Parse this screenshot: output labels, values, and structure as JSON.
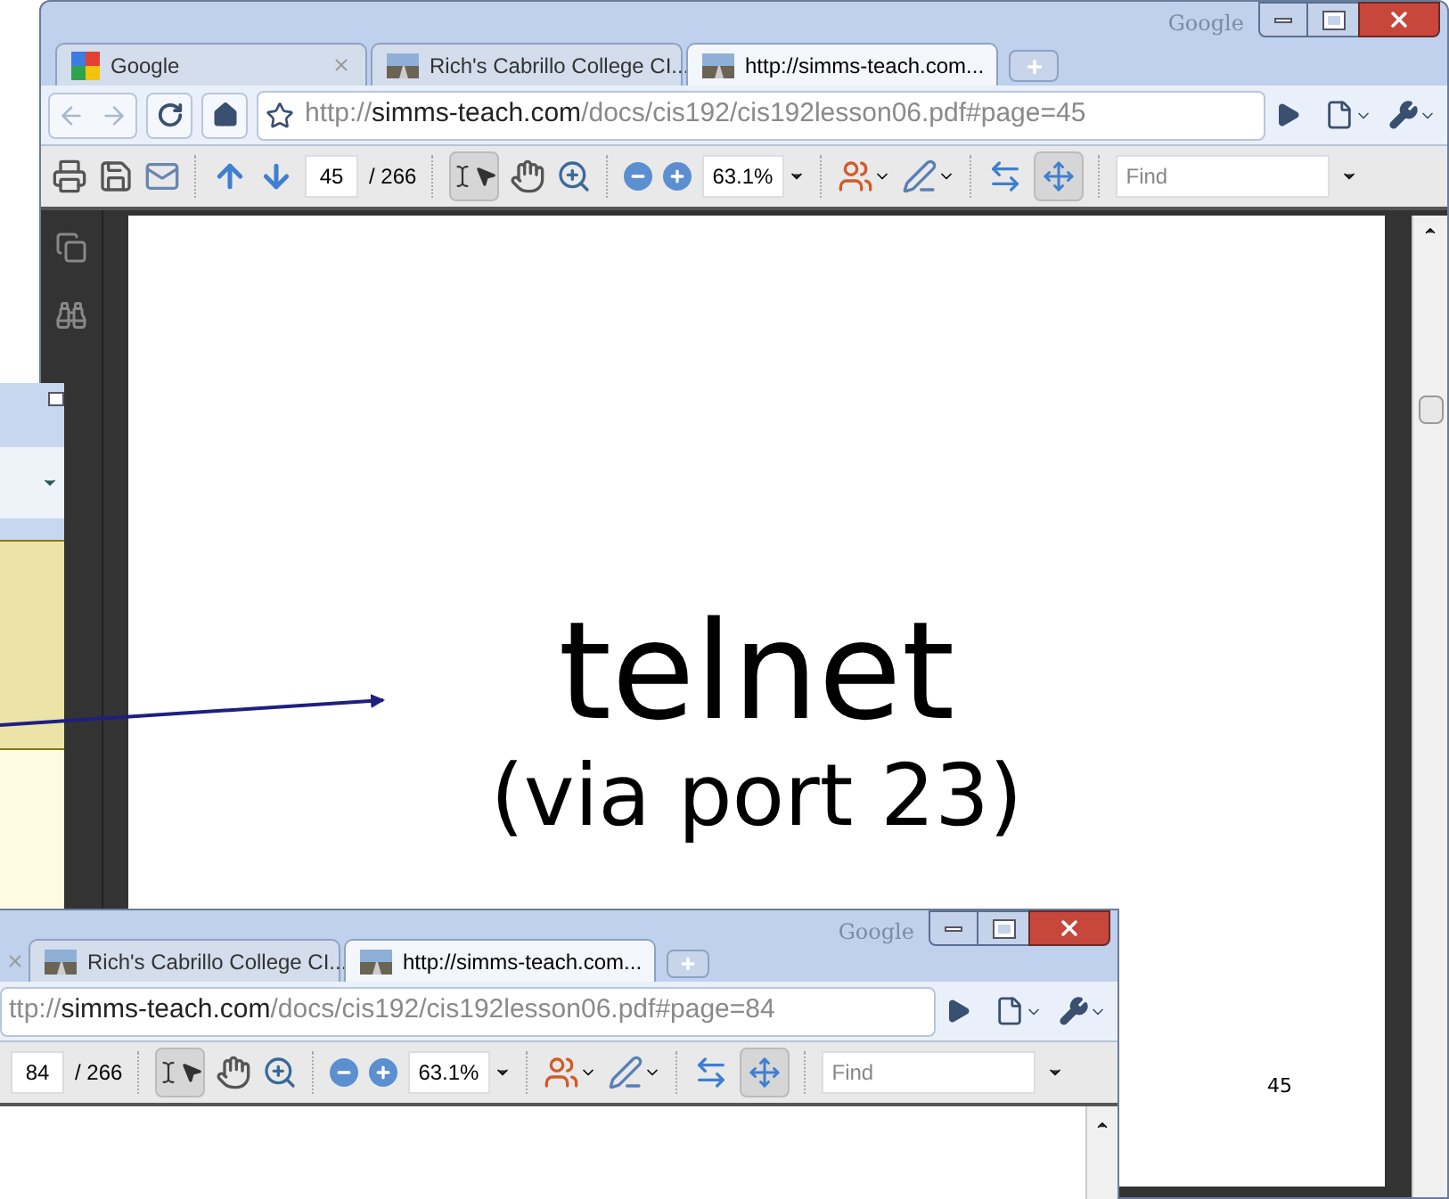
{
  "main_window": {
    "corner_label": "Google",
    "tabs": [
      {
        "title": "Google",
        "kind": "google",
        "selected": false
      },
      {
        "title": "Rich's Cabrillo College CI...",
        "kind": "web",
        "selected": false
      },
      {
        "title": "http://simms-teach.com...",
        "kind": "web",
        "selected": true
      }
    ],
    "url": {
      "scheme": "http://",
      "host": "simms-teach.com",
      "path": "/docs/cis192/cis192lesson06.pdf#page=45"
    },
    "pdf_toolbar": {
      "page": "45",
      "total": "/ 266",
      "zoom": "63.1%",
      "find_placeholder": "Find",
      "select_tool_selected": true,
      "fit_page_selected": true
    },
    "document": {
      "heading": "telnet",
      "subheading": "(via port 23)",
      "page_number": "45"
    }
  },
  "bottom_window": {
    "corner_label": "Google",
    "tabs": [
      {
        "title": "Rich's Cabrillo College CI...",
        "kind": "web",
        "selected": false
      },
      {
        "title": "http://simms-teach.com...",
        "kind": "web",
        "selected": true
      }
    ],
    "url": {
      "scheme": "ttp://",
      "host": "simms-teach.com",
      "path": "/docs/cis192/cis192lesson06.pdf#page=84"
    },
    "pdf_toolbar": {
      "page": "84",
      "total": "/ 266",
      "zoom": "63.1%",
      "find_placeholder": "Find",
      "select_tool_selected": true,
      "fit_page_selected": true
    }
  }
}
